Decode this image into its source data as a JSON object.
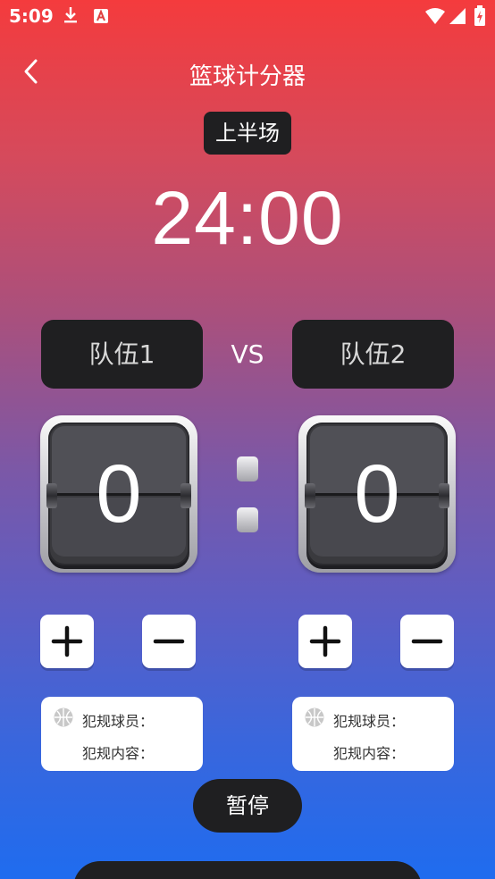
{
  "status_bar": {
    "time": "5:09"
  },
  "header": {
    "title": "篮球计分器"
  },
  "period": {
    "label": "上半场"
  },
  "timer": {
    "value": "24:00"
  },
  "teams": {
    "team1": {
      "name": "队伍1",
      "score": "0"
    },
    "team2": {
      "name": "队伍2",
      "score": "0"
    },
    "vs": "VS"
  },
  "foul": {
    "player_label": "犯规球员：",
    "content_label": "犯规内容："
  },
  "controls": {
    "pause_label": "暂停"
  },
  "colors": {
    "panel": "#1f1f21",
    "gradient_top": "#f43b3d",
    "gradient_bottom": "#1f6cef"
  }
}
